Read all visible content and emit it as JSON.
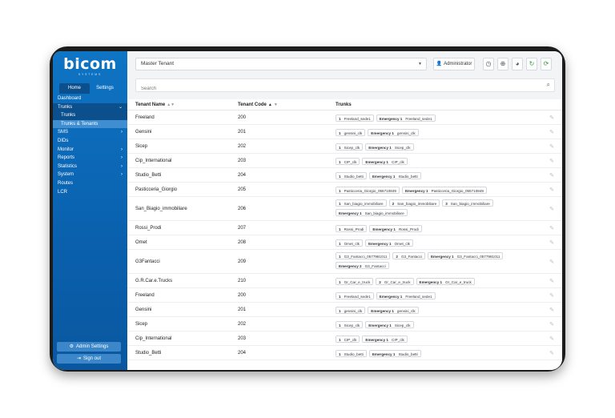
{
  "brand": {
    "logo": "bicom",
    "sub": "SYSTEMS"
  },
  "sidebar": {
    "tabs": [
      {
        "label": "Home",
        "active": true
      },
      {
        "label": "Settings",
        "active": false
      }
    ],
    "nav": [
      {
        "label": "Dashboard"
      },
      {
        "label": "Trunks",
        "caret": "⌄",
        "open": true
      },
      {
        "label": "Trunks",
        "sub": true
      },
      {
        "label": "Trunks & Tenants",
        "sub": true,
        "active": true
      },
      {
        "label": "SMS",
        "caret": "›"
      },
      {
        "label": "DIDs"
      },
      {
        "label": "Monitor",
        "caret": "›"
      },
      {
        "label": "Reports",
        "caret": "›"
      },
      {
        "label": "Statistics",
        "caret": "›"
      },
      {
        "label": "System",
        "caret": "›"
      },
      {
        "label": "Routes"
      },
      {
        "label": "LCR"
      }
    ],
    "admin_settings": "Admin Settings",
    "sign_out": "Sign out"
  },
  "topbar": {
    "tenant": "Master Tenant",
    "user": "Administrator"
  },
  "search": {
    "placeholder": "Search"
  },
  "table": {
    "headers": {
      "name": "Tenant Name",
      "code": "Tenant Code",
      "trunks": "Trunks"
    },
    "rows": [
      {
        "name": "Freeland",
        "code": "200",
        "h": 18,
        "trunks": [
          [
            "1",
            "Freeland_sede1"
          ],
          [
            "Emergency 1",
            "Freeland_sede1"
          ]
        ]
      },
      {
        "name": "Gensini",
        "code": "201",
        "h": 18,
        "trunks": [
          [
            "1",
            "gensini_clk"
          ],
          [
            "Emergency 1",
            "gensini_clk"
          ]
        ]
      },
      {
        "name": "Sicep",
        "code": "202",
        "h": 18,
        "trunks": [
          [
            "1",
            "Sicep_clk"
          ],
          [
            "Emergency 1",
            "Sicep_clk"
          ]
        ]
      },
      {
        "name": "Cip_International",
        "code": "203",
        "h": 18,
        "trunks": [
          [
            "1",
            "CIP_clk"
          ],
          [
            "Emergency 1",
            "CIP_clk"
          ]
        ]
      },
      {
        "name": "Studio_Betti",
        "code": "204",
        "h": 18,
        "trunks": [
          [
            "1",
            "Studio_betti"
          ],
          [
            "Emergency 1",
            "Studio_betti"
          ]
        ]
      },
      {
        "name": "Pasticceria_Giorgio",
        "code": "205",
        "h": 18,
        "trunks": [
          [
            "1",
            "Pasticceria_Giorgio_055710849"
          ],
          [
            "Emergency 1",
            "Pasticceria_Giorgio_055710849"
          ]
        ]
      },
      {
        "name": "San_Biagio_immobiliare",
        "code": "206",
        "h": 30,
        "trunks": [
          [
            "1",
            "San_biagio_immobiliare"
          ],
          [
            "2",
            "San_biagio_immobiliare"
          ],
          [
            "3",
            "San_biagio_immobiliare"
          ],
          [
            "Emergency 1",
            "San_biagio_immobiliare"
          ]
        ]
      },
      {
        "name": "Rossi_Prodi",
        "code": "207",
        "h": 18,
        "trunks": [
          [
            "1",
            "Rossi_Prodi"
          ],
          [
            "Emergency 1",
            "Rossi_Prodi"
          ]
        ]
      },
      {
        "name": "Omet",
        "code": "208",
        "h": 18,
        "trunks": [
          [
            "1",
            "Omet_clk"
          ],
          [
            "Emergency 1",
            "Omet_clk"
          ]
        ]
      },
      {
        "name": "G3Fantacci",
        "code": "209",
        "h": 30,
        "trunks": [
          [
            "1",
            "G3_Fantacci_0577981011"
          ],
          [
            "2",
            "G3_Fantacci"
          ],
          [
            "Emergency 1",
            "G3_Fantacci_0577981011"
          ],
          [
            "Emergency 2",
            "G3_Fantacci"
          ]
        ]
      },
      {
        "name": "G.R.Car.e.Trucks",
        "code": "210",
        "h": 18,
        "trunks": [
          [
            "1",
            "Gr_Car_e_truck"
          ],
          [
            "2",
            "Gr_Car_e_truck"
          ],
          [
            "Emergency 1",
            "Gr_Car_e_truck"
          ]
        ]
      },
      {
        "name": "Freeland",
        "code": "200",
        "h": 18,
        "trunks": [
          [
            "1",
            "Freeland_sede1"
          ],
          [
            "Emergency 1",
            "Freeland_sede1"
          ]
        ]
      },
      {
        "name": "Gensini",
        "code": "201",
        "h": 18,
        "trunks": [
          [
            "1",
            "gensini_clk"
          ],
          [
            "Emergency 1",
            "gensini_clk"
          ]
        ]
      },
      {
        "name": "Sicep",
        "code": "202",
        "h": 18,
        "trunks": [
          [
            "1",
            "Sicep_clk"
          ],
          [
            "Emergency 1",
            "Sicep_clk"
          ]
        ]
      },
      {
        "name": "Cip_International",
        "code": "203",
        "h": 18,
        "trunks": [
          [
            "1",
            "CIP_clk"
          ],
          [
            "Emergency 1",
            "CIP_clk"
          ]
        ]
      },
      {
        "name": "Studio_Betti",
        "code": "204",
        "h": 18,
        "trunks": [
          [
            "1",
            "Studio_betti"
          ],
          [
            "Emergency 1",
            "Studio_betti"
          ]
        ]
      }
    ]
  }
}
